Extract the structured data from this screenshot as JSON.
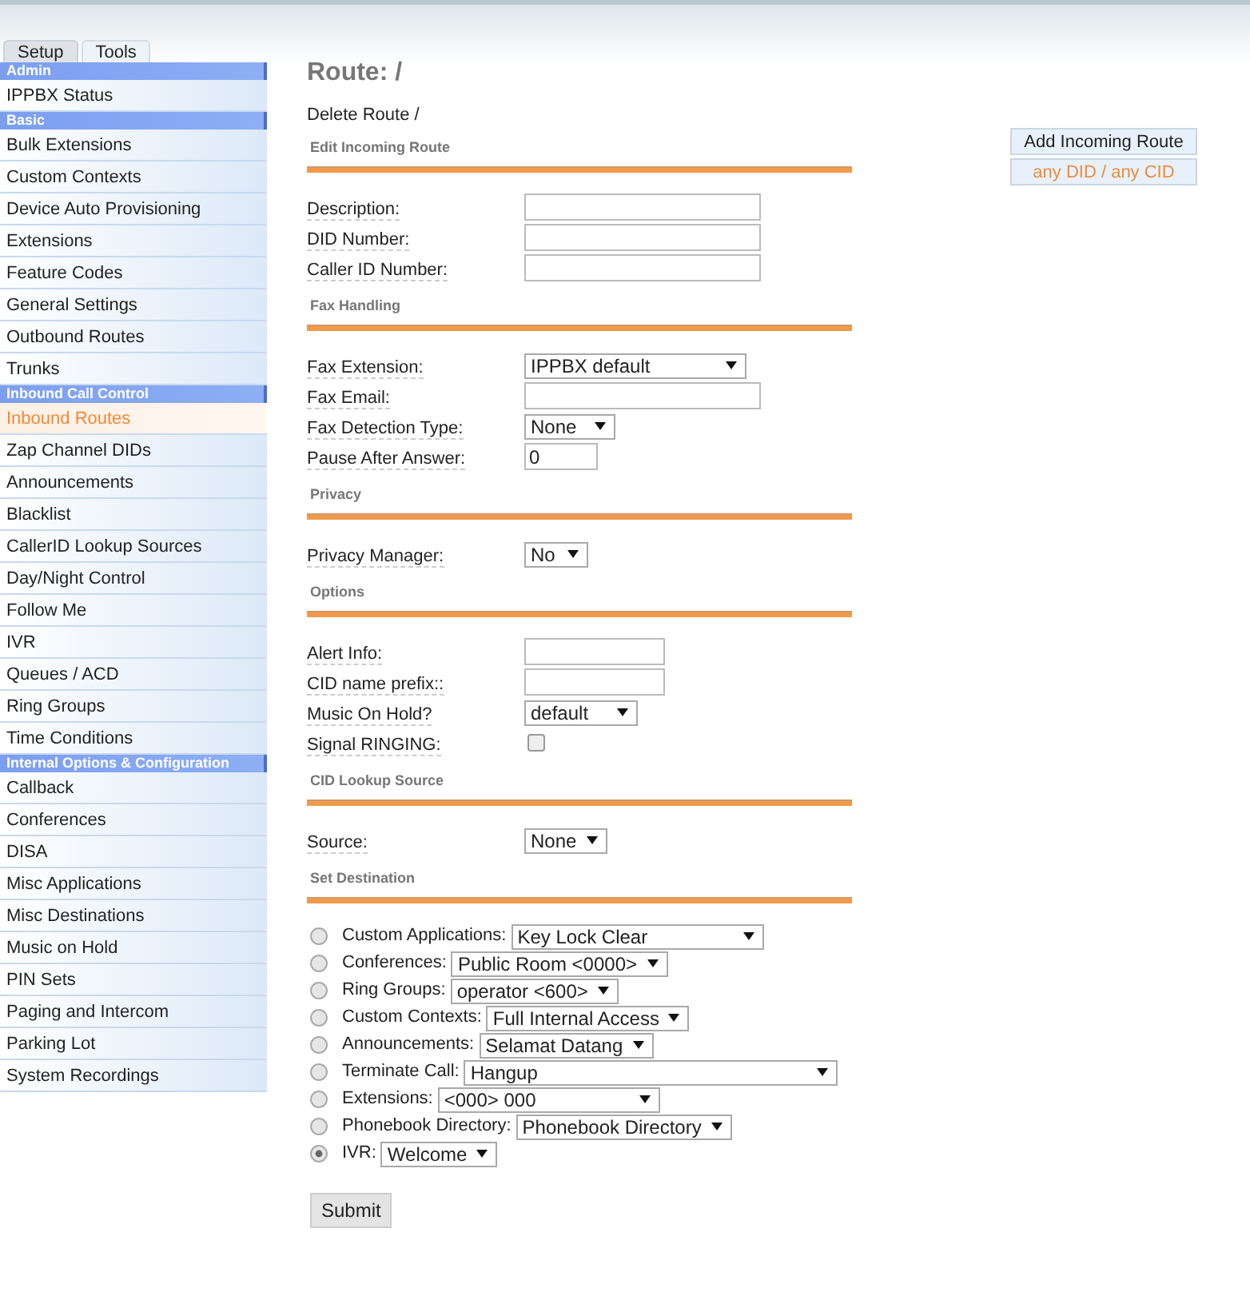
{
  "tabs": [
    {
      "label": "Setup",
      "selected": true
    },
    {
      "label": "Tools",
      "selected": false
    }
  ],
  "sidebar": {
    "groups": [
      {
        "title": "Admin",
        "items": [
          {
            "label": "IPPBX Status",
            "selected": false
          }
        ]
      },
      {
        "title": "Basic",
        "items": [
          {
            "label": "Bulk Extensions",
            "selected": false
          },
          {
            "label": "Custom Contexts",
            "selected": false
          },
          {
            "label": "Device Auto Provisioning",
            "selected": false
          },
          {
            "label": "Extensions",
            "selected": false
          },
          {
            "label": "Feature Codes",
            "selected": false
          },
          {
            "label": "General Settings",
            "selected": false
          },
          {
            "label": "Outbound Routes",
            "selected": false
          },
          {
            "label": "Trunks",
            "selected": false
          }
        ]
      },
      {
        "title": "Inbound Call Control",
        "items": [
          {
            "label": "Inbound Routes",
            "selected": true
          },
          {
            "label": "Zap Channel DIDs",
            "selected": false
          },
          {
            "label": "Announcements",
            "selected": false
          },
          {
            "label": "Blacklist",
            "selected": false
          },
          {
            "label": "CallerID Lookup Sources",
            "selected": false
          },
          {
            "label": "Day/Night Control",
            "selected": false
          },
          {
            "label": "Follow Me",
            "selected": false
          },
          {
            "label": "IVR",
            "selected": false
          },
          {
            "label": "Queues / ACD",
            "selected": false
          },
          {
            "label": "Ring Groups",
            "selected": false
          },
          {
            "label": "Time Conditions",
            "selected": false
          }
        ]
      },
      {
        "title": "Internal Options & Configuration",
        "items": [
          {
            "label": "Callback",
            "selected": false
          },
          {
            "label": "Conferences",
            "selected": false
          },
          {
            "label": "DISA",
            "selected": false
          },
          {
            "label": "Misc Applications",
            "selected": false
          },
          {
            "label": "Misc Destinations",
            "selected": false
          },
          {
            "label": "Music on Hold",
            "selected": false
          },
          {
            "label": "PIN Sets",
            "selected": false
          },
          {
            "label": "Paging and Intercom",
            "selected": false
          },
          {
            "label": "Parking Lot",
            "selected": false
          },
          {
            "label": "System Recordings",
            "selected": false
          }
        ]
      }
    ]
  },
  "title": "Route: /",
  "delete_link": "Delete Route /",
  "sections": [
    {
      "heading": "Edit Incoming Route",
      "fields": [
        {
          "kind": "text",
          "label": "Description:"
        },
        {
          "kind": "text",
          "label": "DID Number:"
        },
        {
          "kind": "text",
          "label": "Caller ID Number:"
        }
      ]
    },
    {
      "heading": "Fax Handling",
      "fields": [
        {
          "kind": "select",
          "label": "Fax Extension:",
          "value": "IPPBX default"
        },
        {
          "kind": "text",
          "label": "Fax Email:"
        },
        {
          "kind": "select",
          "label": "Fax Detection Type:",
          "value": "None"
        },
        {
          "kind": "text",
          "label": "Pause After Answer:",
          "value": "0"
        }
      ]
    },
    {
      "heading": "Privacy",
      "fields": [
        {
          "kind": "select",
          "label": "Privacy Manager:",
          "value": "No"
        }
      ]
    },
    {
      "heading": "Options",
      "fields": [
        {
          "kind": "text",
          "label": "Alert Info:"
        },
        {
          "kind": "text",
          "label": "CID name prefix::"
        },
        {
          "kind": "select",
          "label": "Music On Hold?",
          "value": "default"
        },
        {
          "kind": "checkbox",
          "label": "Signal RINGING:",
          "checked": false
        }
      ]
    },
    {
      "heading": "CID Lookup Source",
      "fields": [
        {
          "kind": "select",
          "label": "Source:",
          "value": "None"
        }
      ]
    },
    {
      "heading": "Set Destination",
      "destinations": [
        {
          "label": "Custom Applications:",
          "value": "Key Lock Clear",
          "selected": false
        },
        {
          "label": "Conferences:",
          "value": "Public Room <0000>",
          "selected": false
        },
        {
          "label": "Ring Groups:",
          "value": "operator <600>",
          "selected": false
        },
        {
          "label": "Custom Contexts:",
          "value": "Full Internal Access",
          "selected": false
        },
        {
          "label": "Announcements:",
          "value": "Selamat Datang",
          "selected": false
        },
        {
          "label": "Terminate Call:",
          "value": "Hangup",
          "selected": false
        },
        {
          "label": "Extensions:",
          "value": "<000> 000",
          "selected": false
        },
        {
          "label": "Phonebook Directory:",
          "value": "Phonebook Directory",
          "selected": false
        },
        {
          "label": "IVR:",
          "value": "Welcome",
          "selected": true
        }
      ]
    }
  ],
  "submit": "Submit",
  "side_panel": [
    {
      "label": "Add Incoming Route",
      "selected": false
    },
    {
      "label": "any DID / any CID",
      "selected": true
    }
  ]
}
